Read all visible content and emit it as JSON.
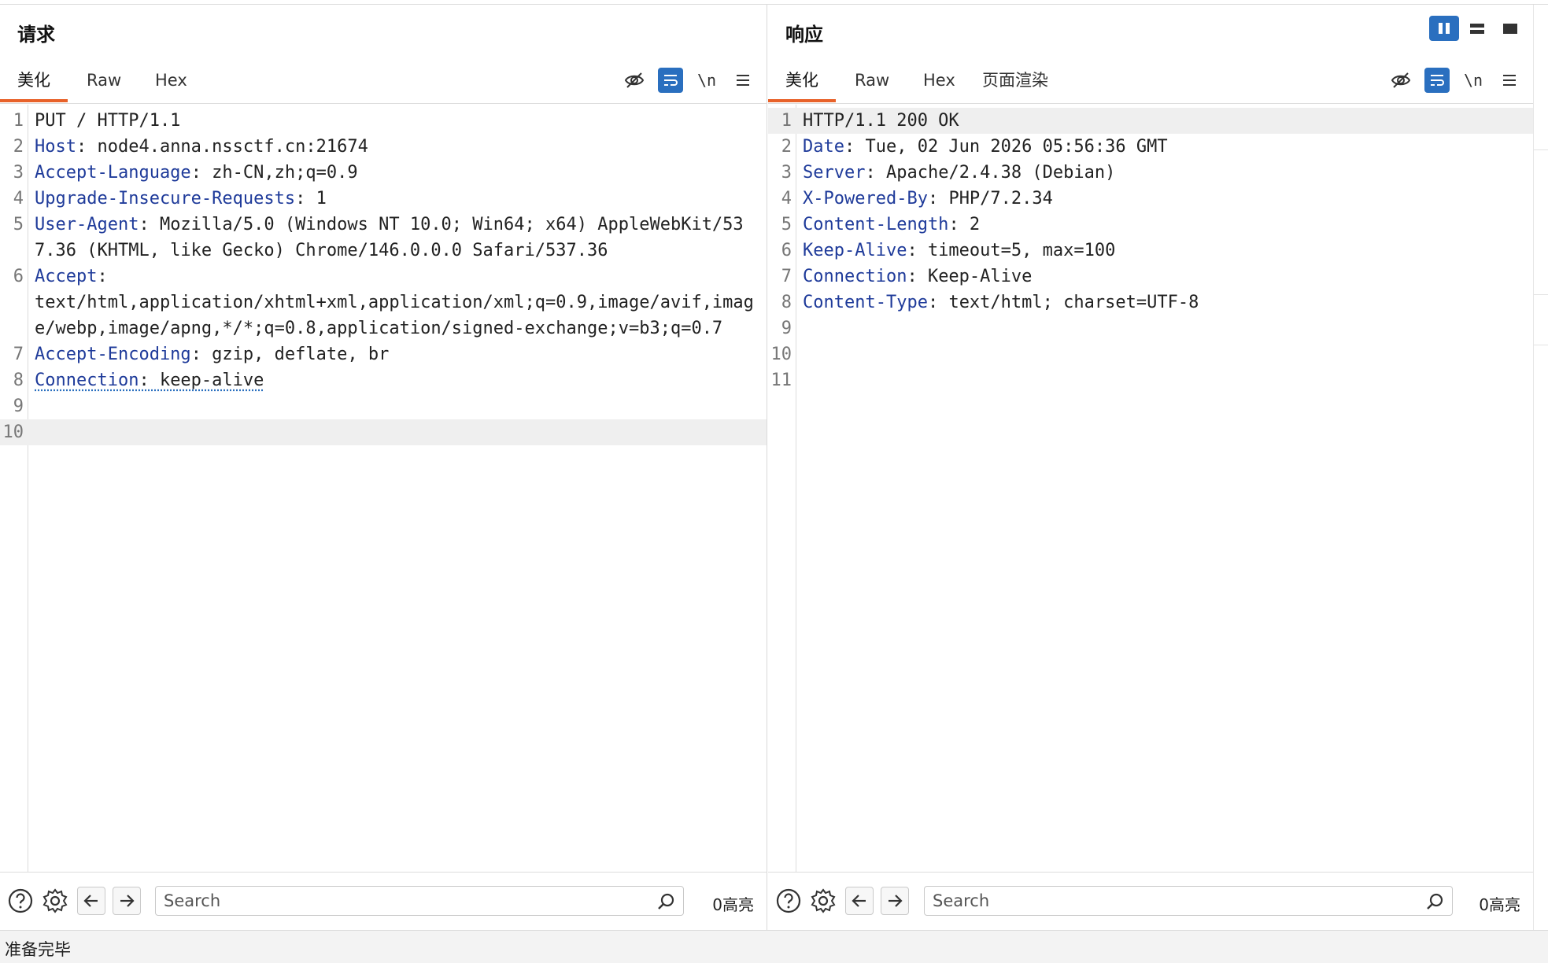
{
  "request": {
    "title": "请求",
    "tabs": [
      "美化",
      "Raw",
      "Hex"
    ],
    "active_tab": "美化",
    "newline_label": "\\n",
    "lines": [
      {
        "n": "1",
        "name": "",
        "value": "PUT / HTTP/1.1"
      },
      {
        "n": "2",
        "name": "Host",
        "value": ": node4.anna.nssctf.cn:21674"
      },
      {
        "n": "3",
        "name": "Accept-Language",
        "value": ": zh-CN,zh;q=0.9"
      },
      {
        "n": "4",
        "name": "Upgrade-Insecure-Requests",
        "value": ": 1"
      },
      {
        "n": "5",
        "name": "User-Agent",
        "value": ": Mozilla/5.0 (Windows NT 10.0; Win64; x64) AppleWebKit/537.36 (KHTML, like Gecko) Chrome/146.0.0.0 Safari/537.36"
      },
      {
        "n": "6",
        "name": "Accept",
        "value": ":\ntext/html,application/xhtml+xml,application/xml;q=0.9,image/avif,image/webp,image/apng,*/*;q=0.8,application/signed-exchange;v=b3;q=0.7"
      },
      {
        "n": "7",
        "name": "Accept-Encoding",
        "value": ": gzip, deflate, br"
      },
      {
        "n": "8",
        "name": "Connection",
        "value": ": keep-alive"
      },
      {
        "n": "9",
        "name": "",
        "value": ""
      },
      {
        "n": "10",
        "name": "",
        "value": ""
      }
    ],
    "search_placeholder": "Search",
    "highlight_count": "0高亮"
  },
  "response": {
    "title": "响应",
    "tabs": [
      "美化",
      "Raw",
      "Hex",
      "页面渲染"
    ],
    "active_tab": "美化",
    "newline_label": "\\n",
    "lines": [
      {
        "n": "1",
        "name": "",
        "value": "HTTP/1.1 200 OK"
      },
      {
        "n": "2",
        "name": "Date",
        "value": ": Tue, 02 Jun 2026 05:56:36 GMT"
      },
      {
        "n": "3",
        "name": "Server",
        "value": ": Apache/2.4.38 (Debian)"
      },
      {
        "n": "4",
        "name": "X-Powered-By",
        "value": ": PHP/7.2.34"
      },
      {
        "n": "5",
        "name": "Content-Length",
        "value": ": 2"
      },
      {
        "n": "6",
        "name": "Keep-Alive",
        "value": ": timeout=5, max=100"
      },
      {
        "n": "7",
        "name": "Connection",
        "value": ": Keep-Alive"
      },
      {
        "n": "8",
        "name": "Content-Type",
        "value": ": text/html; charset=UTF-8"
      },
      {
        "n": "9",
        "name": "",
        "value": ""
      },
      {
        "n": "10",
        "name": "",
        "value": ""
      },
      {
        "n": "11",
        "name": "",
        "value": ""
      }
    ],
    "search_placeholder": "Search",
    "highlight_count": "0高亮"
  },
  "view_modes": [
    "split-vertical-icon",
    "split-horizontal-icon",
    "single-pane-icon"
  ],
  "active_view_mode": "split-vertical-icon",
  "status_text": "准备完毕",
  "colors": {
    "accent": "#2a6fbf",
    "tab_active": "#e8622a",
    "header_name": "#1f3b9a"
  }
}
